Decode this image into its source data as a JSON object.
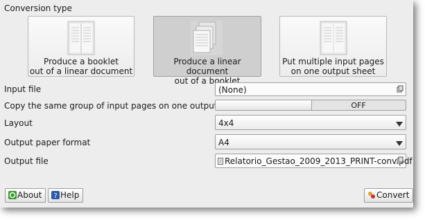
{
  "conversion": {
    "title": "Conversion type",
    "options": [
      {
        "label": "Produce a booklet\nout of a linear document",
        "selected": false
      },
      {
        "label": "Produce a linear document\nout of a booklet",
        "selected": true
      },
      {
        "label": "Put multiple input pages\non one output sheet",
        "selected": false
      }
    ]
  },
  "form": {
    "input_file_label": "Input file",
    "input_file_value": "(None)",
    "copy_group_label": "Copy the same group of input pages on one output page",
    "copy_group_state": "OFF",
    "layout_label": "Layout",
    "layout_value": "4x4",
    "paper_label": "Output paper format",
    "paper_value": "A4",
    "output_file_label": "Output file",
    "output_file_value": "Relatorio_Gestao_2009_2013_PRINT-conv.pdf"
  },
  "buttons": {
    "about": "About",
    "help": "Help",
    "convert": "Convert"
  },
  "icons": {
    "about": "about-icon",
    "help": "help-icon",
    "convert": "convert-icon",
    "file_browse": "file-browse-icon",
    "dropdown": "chevron-down-icon"
  }
}
